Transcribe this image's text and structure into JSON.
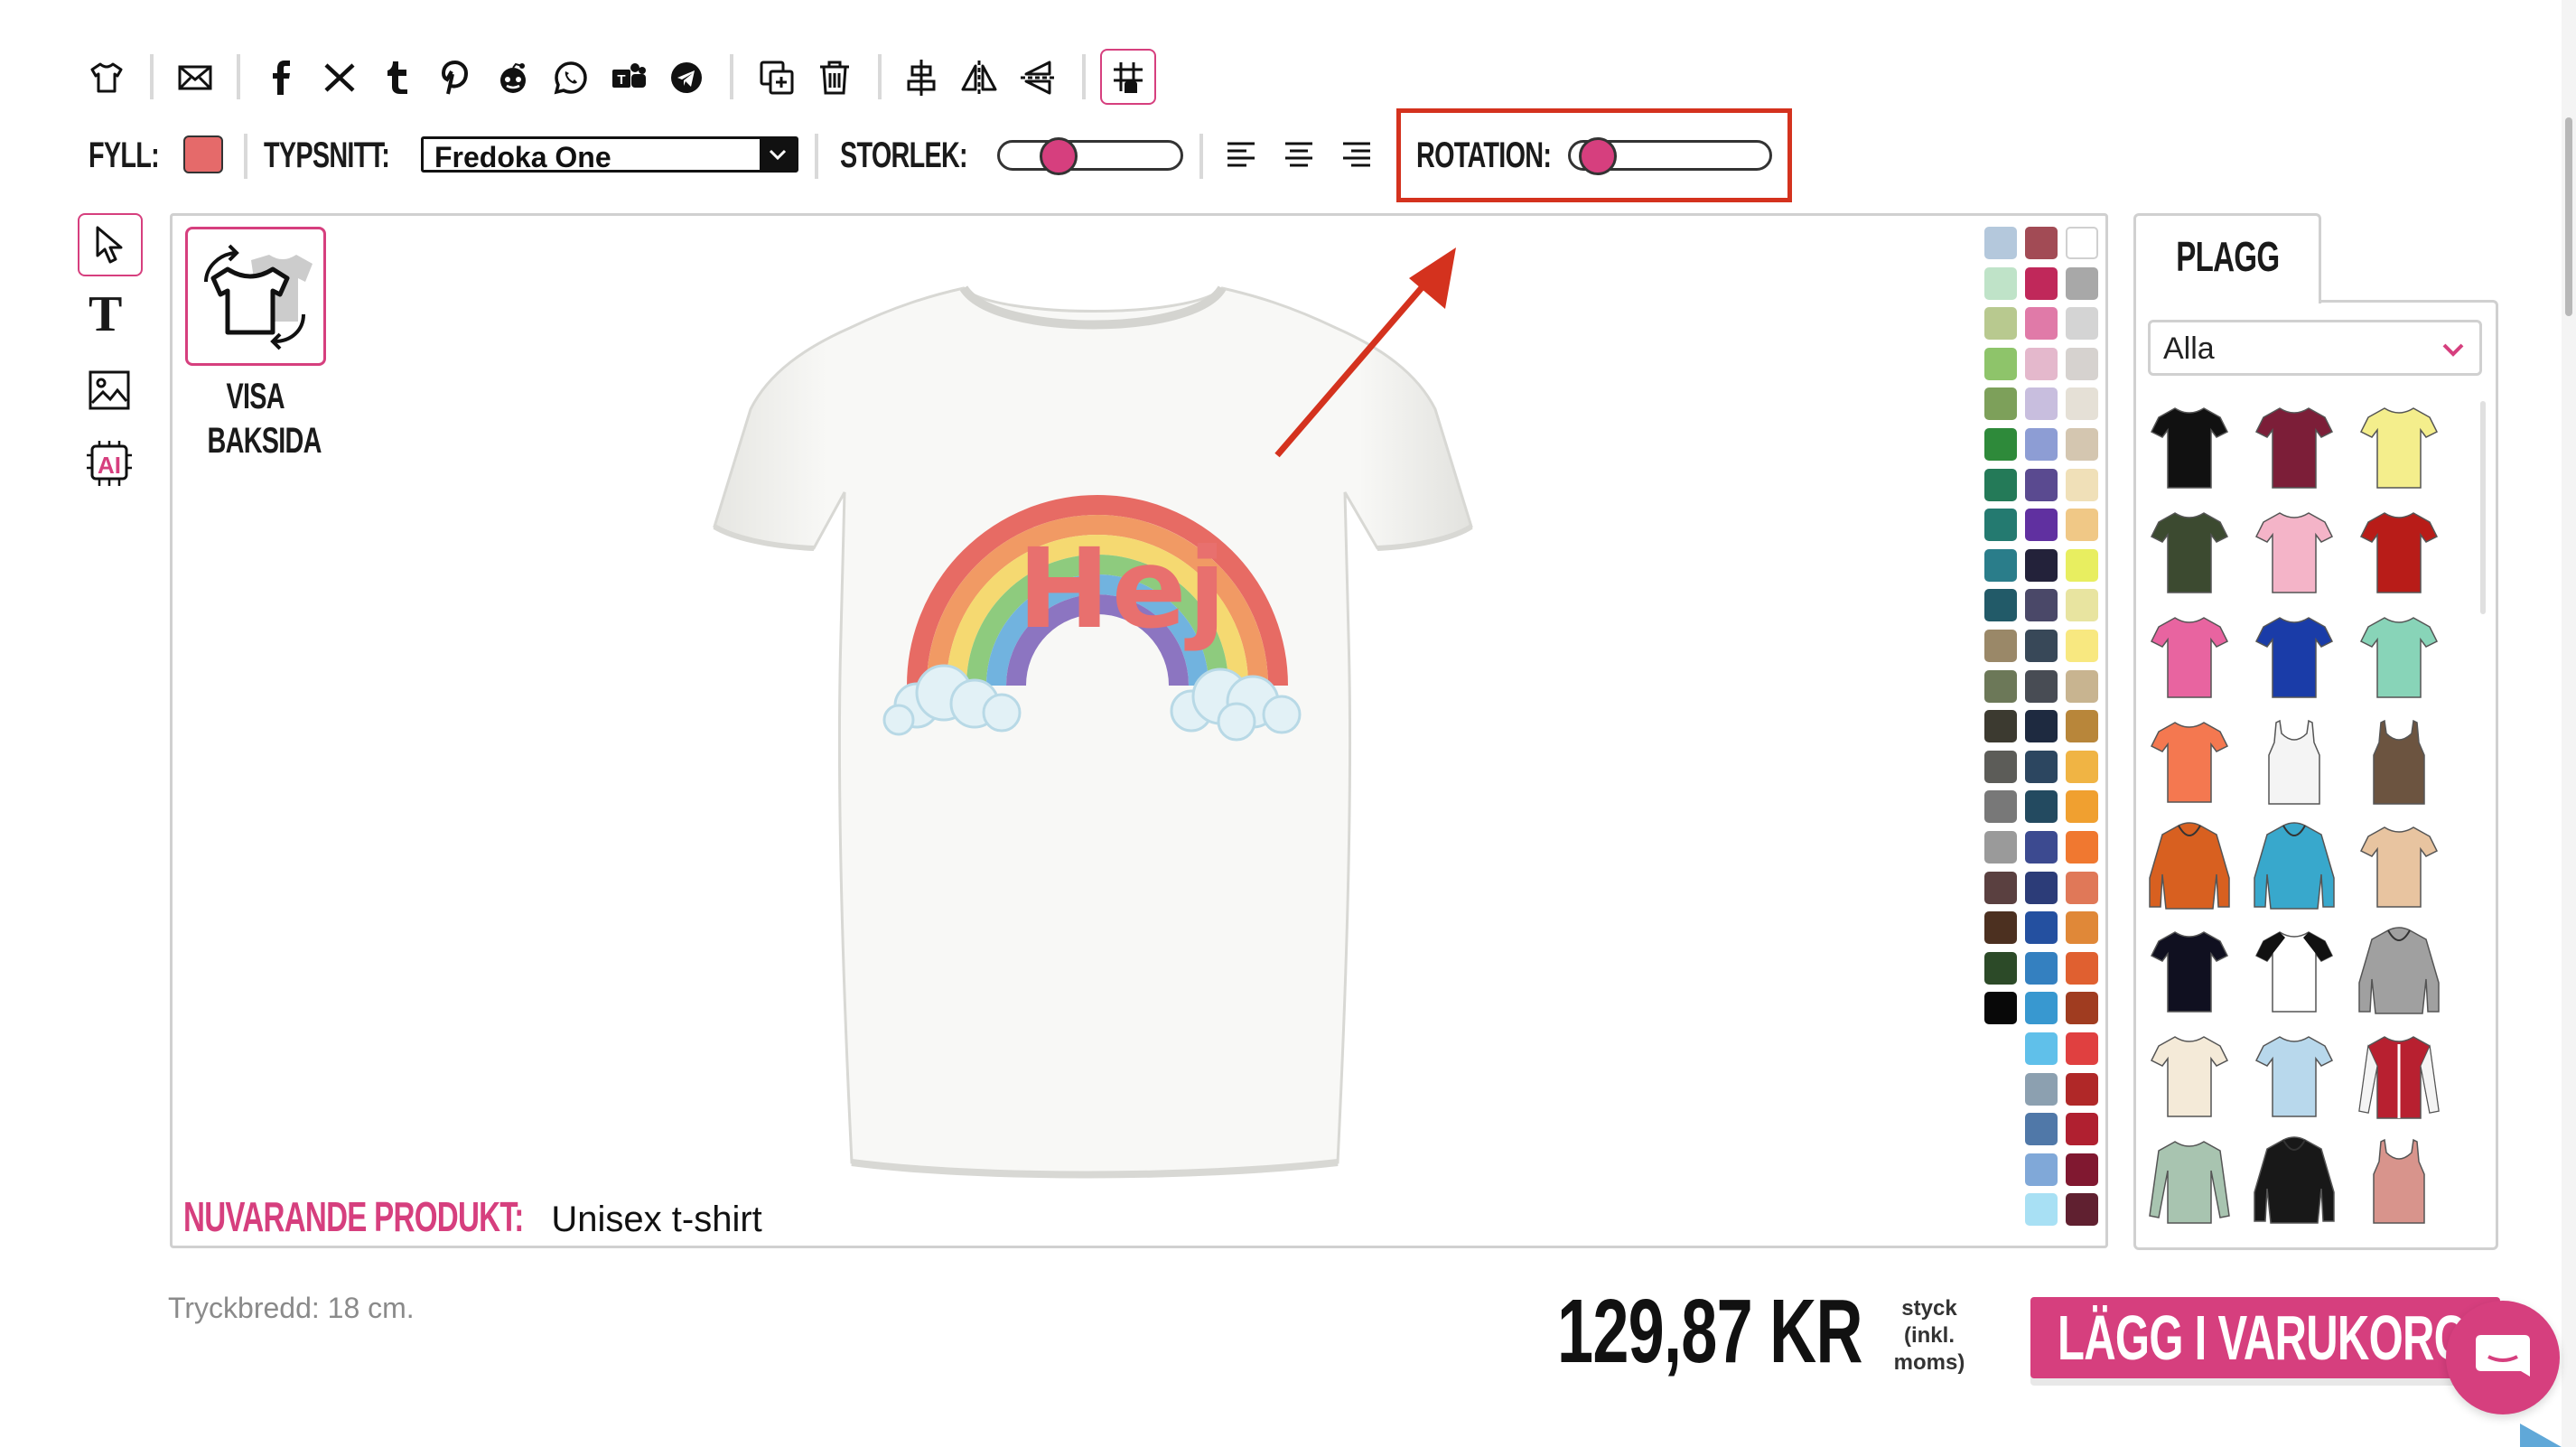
{
  "toolbar": {
    "icons": [
      "tshirt-icon",
      "mail-icon",
      "facebook-icon",
      "x-twitter-icon",
      "tumblr-icon",
      "pinterest-icon",
      "reddit-icon",
      "whatsapp-icon",
      "teams-icon",
      "telegram-icon",
      "duplicate-icon",
      "trash-icon",
      "align-center-icon",
      "flip-horizontal-icon",
      "flip-vertical-icon",
      "grid-snap-icon"
    ]
  },
  "controls": {
    "fill_label": "FYLL:",
    "fill_color": "#e56a6a",
    "font_label": "TYPSNITT:",
    "font_value": "Fredoka One",
    "size_label": "STORLEK:",
    "size_value": 0.28,
    "rotation_label": "ROTATION:",
    "rotation_value": 0.05
  },
  "tools": [
    "pointer-tool-icon",
    "text-tool-icon",
    "image-tool-icon",
    "ai-tool-icon"
  ],
  "canvas": {
    "view_back_label_1": "VISA",
    "view_back_label_2": "BAKSIDA",
    "design_text": "Hej",
    "design_text_color": "#e8706e",
    "current_product_label": "NUVARANDE PRODUKT:",
    "current_product_value": "Unisex t-shirt"
  },
  "color_palette": [
    [
      "#b4c8dc",
      "#a24b55",
      "#ffffff"
    ],
    [
      "#bfe3c8",
      "#c0285a",
      "#a8a8a8"
    ],
    [
      "#b8c98f",
      "#e07aa8",
      "#d4d4d4"
    ],
    [
      "#8ec46a",
      "#e4b8cc",
      "#d6d2cf"
    ],
    [
      "#7da05a",
      "#c8bede",
      "#e5e0d6"
    ],
    [
      "#2e8a3a",
      "#8d9dd4",
      "#d4c6b0"
    ],
    [
      "#247a58",
      "#5a4a90",
      "#f0e0b8"
    ],
    [
      "#247a70",
      "#6030a0",
      "#f0c886"
    ],
    [
      "#2a7d8a",
      "#23223a",
      "#e8ee60"
    ],
    [
      "#225a68",
      "#4a4868",
      "#e8e4a0"
    ],
    [
      "#9a8868",
      "#384858",
      "#f8e880"
    ],
    [
      "#6c7858",
      "#484c54",
      "#c8b490"
    ],
    [
      "#3c3a30",
      "#1e2a40",
      "#b8863a"
    ],
    [
      "#5c5c58",
      "#2c4660",
      "#f0b444"
    ],
    [
      "#787878",
      "#234a60",
      "#f0a030"
    ],
    [
      "#9a9a9a",
      "#3c4a90",
      "#f07830"
    ],
    [
      "#5a4040",
      "#2c3c78",
      "#e07858"
    ],
    [
      "#4c3020",
      "#2450a0",
      "#e08838"
    ],
    [
      "#2c4a28",
      "#3480c0",
      "#e06030"
    ],
    [
      "#080808",
      "#3898d0",
      "#a03c20"
    ],
    [
      null,
      "#60c0ea",
      "#e04040"
    ],
    [
      null,
      "#8ca0b0",
      "#b02828"
    ],
    [
      null,
      "#5078a8",
      "#b02030"
    ],
    [
      null,
      "#80a8d8",
      "#801830"
    ],
    [
      null,
      "#a8e0f4",
      "#602030"
    ]
  ],
  "products_panel": {
    "tab_label": "PLAGG",
    "filter_value": "Alla",
    "items": [
      {
        "name": "black-tshirt",
        "type": "tee",
        "color": "#111111"
      },
      {
        "name": "maroon-tshirt",
        "type": "tee",
        "color": "#7c1e38"
      },
      {
        "name": "yellow-tshirt",
        "type": "tee",
        "color": "#f4ee8c"
      },
      {
        "name": "olive-tshirt",
        "type": "tee",
        "color": "#3c4a30"
      },
      {
        "name": "pink-women-tshirt",
        "type": "tee",
        "color": "#f4b4c8"
      },
      {
        "name": "red-tshirt",
        "type": "tee",
        "color": "#b81c18"
      },
      {
        "name": "fuchsia-women-tshirt",
        "type": "tee",
        "color": "#e864a0"
      },
      {
        "name": "royal-blue-tshirt",
        "type": "tee",
        "color": "#1a3ca8"
      },
      {
        "name": "mint-tshirt",
        "type": "tee",
        "color": "#88d4b8"
      },
      {
        "name": "coral-women-tshirt",
        "type": "tee",
        "color": "#f47850"
      },
      {
        "name": "white-tank-top",
        "type": "tank",
        "color": "#f4f4f4"
      },
      {
        "name": "brown-tank-top",
        "type": "tank",
        "color": "#6c5440"
      },
      {
        "name": "orange-hoodie",
        "type": "hoodie",
        "color": "#d86020"
      },
      {
        "name": "turquoise-hoodie",
        "type": "hoodie",
        "color": "#38a8cc"
      },
      {
        "name": "tie-dye-tshirt",
        "type": "tee",
        "color": "#e8c4a0"
      },
      {
        "name": "black-v-tshirt",
        "type": "tee",
        "color": "#101020"
      },
      {
        "name": "raglan-tshirt",
        "type": "raglan",
        "color": "#ffffff"
      },
      {
        "name": "grey-hoodie",
        "type": "hoodie",
        "color": "#a0a0a0"
      },
      {
        "name": "cream-tshirt",
        "type": "tee",
        "color": "#f4ead8"
      },
      {
        "name": "gradient-tshirt",
        "type": "tee",
        "color": "#b8d8ec"
      },
      {
        "name": "college-jacket",
        "type": "jacket",
        "color": "#b82030"
      },
      {
        "name": "sage-longsleeve",
        "type": "longsleeve",
        "color": "#a8c4b0"
      },
      {
        "name": "black-orange-hoodie",
        "type": "hoodie",
        "color": "#181818"
      },
      {
        "name": "rose-tank-top",
        "type": "tank",
        "color": "#d8948c"
      }
    ]
  },
  "footer": {
    "print_width": "Tryckbredd: 18 cm.",
    "price": "129,87 KR",
    "price_note_1": "styck",
    "price_note_2": "(inkl.",
    "price_note_3": "moms)",
    "add_to_cart": "LÄGG I VARUKORGEN"
  },
  "colors": {
    "brand_pink": "#d63f7e",
    "highlight_red": "#d4321e"
  }
}
